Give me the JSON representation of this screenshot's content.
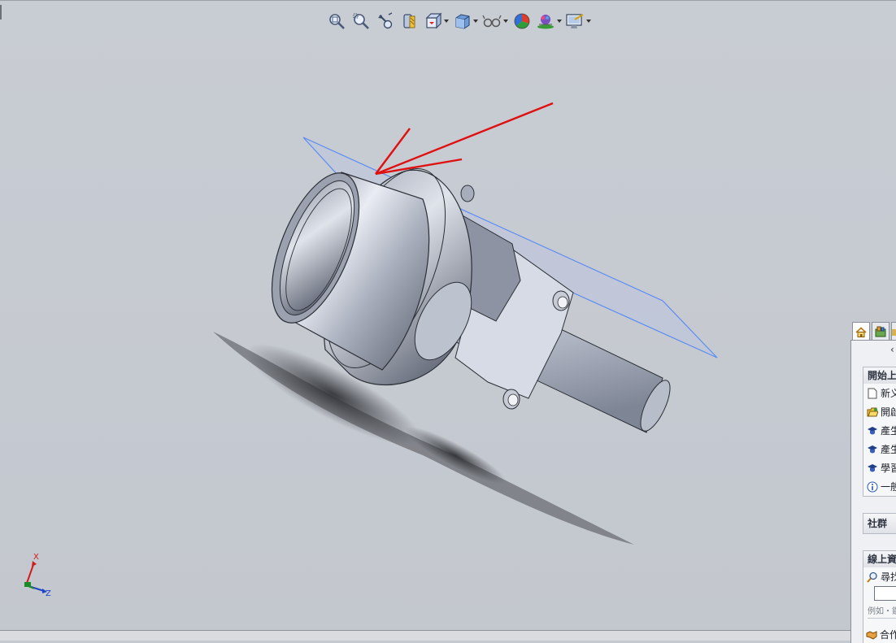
{
  "toolbar": {
    "items": [
      {
        "icon": "zoom-to-fit-icon"
      },
      {
        "icon": "zoom-to-area-icon"
      },
      {
        "icon": "previous-view-icon"
      },
      {
        "icon": "section-view-icon"
      },
      {
        "icon": "view-orientation-icon",
        "dropdown": true
      },
      {
        "icon": "display-style-icon",
        "dropdown": true
      },
      {
        "icon": "hide-show-items-icon",
        "dropdown": true
      },
      {
        "icon": "edit-appearance-icon"
      },
      {
        "icon": "apply-scene-icon",
        "dropdown": true
      },
      {
        "icon": "view-settings-icon",
        "dropdown": true
      }
    ]
  },
  "triad": {
    "x_label": "X",
    "z_label": "Z"
  },
  "task_pane": {
    "tabs": [
      {
        "icon": "solidworks-resources-home-icon"
      },
      {
        "icon": "design-library-icon"
      },
      {
        "icon": "file-explorer-icon"
      }
    ],
    "header_glyph": "‹",
    "getting_started": {
      "title": "開始上",
      "items": [
        {
          "icon": "new-document-icon",
          "label": "新义"
        },
        {
          "icon": "open-folder-icon",
          "label": "開啟"
        },
        {
          "icon": "graduation-cap-icon",
          "label": "產生"
        },
        {
          "icon": "graduation-cap-icon",
          "label": "產生"
        },
        {
          "icon": "graduation-cap-icon",
          "label": "學習"
        },
        {
          "icon": "info-icon",
          "label": "一般"
        }
      ]
    },
    "community": {
      "title": "社群"
    },
    "online_resources": {
      "title": "線上資",
      "search_label": "尋找",
      "search_value": "",
      "search_hint": "例如・鑽",
      "partner_label": "合作"
    }
  },
  "colors": {
    "viewport_bg": "#c6cad1",
    "plane": "#5b8cf2",
    "annotation_arrow": "#e01010"
  }
}
